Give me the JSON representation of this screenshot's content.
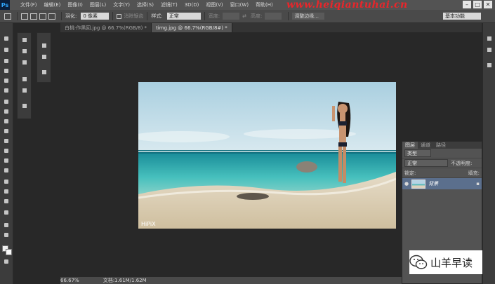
{
  "app": {
    "logo": "Ps"
  },
  "menu": [
    "文件(F)",
    "编辑(E)",
    "图像(I)",
    "图层(L)",
    "文字(Y)",
    "选择(S)",
    "滤镜(T)",
    "3D(D)",
    "视图(V)",
    "窗口(W)",
    "帮助(H)"
  ],
  "watermark": "www.heiqiantuhai.cn",
  "window_buttons": [
    "–",
    "□",
    "✕"
  ],
  "options": {
    "feather_label": "羽化:",
    "feather_value": "0 像素",
    "antialias_label": "消除锯齿",
    "style_label": "样式:",
    "style_value": "正常",
    "width_label": "宽度:",
    "height_label": "高度:",
    "refine_label": "调整边缘...",
    "workspace": "基本功能"
  },
  "tabs": [
    {
      "label": "白桃·作黑回.jpg @ 66.7%(RGB/8) *",
      "active": false
    },
    {
      "label": "timg.jpg @ 66.7%(RGB/8#) *",
      "active": true
    }
  ],
  "status": {
    "zoom": "66.67%",
    "doc": "文档:1.61M/1.62M"
  },
  "layers_panel": {
    "tabs": [
      "图层",
      "通道",
      "路径"
    ],
    "kind": "类型",
    "blend_mode": "正常",
    "opacity_label": "不透明度:",
    "lock_label": "锁定:",
    "fill_label": "填充:",
    "layer_name": "背景"
  },
  "photo_watermark": "HiPiX",
  "wechat": {
    "name": "山羊早读",
    "icon": "wechat-icon"
  },
  "colors": {
    "accent": "#31a8ff",
    "watermark": "#e8262b",
    "selected_layer": "#5b6f8d"
  }
}
